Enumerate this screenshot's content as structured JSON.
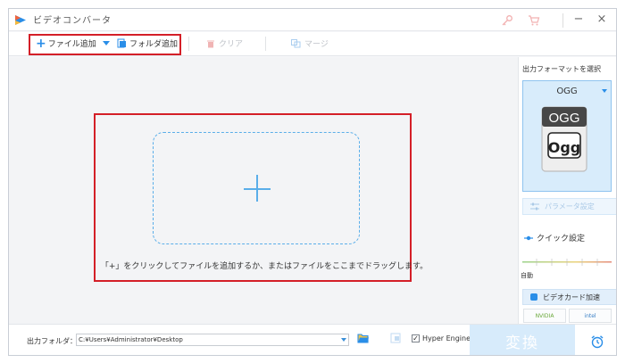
{
  "window": {
    "title": "ビデオコンバータ",
    "controls": {
      "minimize": "−",
      "maximize": "□",
      "close": "×"
    },
    "icons": [
      "app-logo-icon",
      "key-icon",
      "cart-icon"
    ]
  },
  "toolbar": {
    "add_file": "ファイル追加",
    "add_folder": "フォルダ追加",
    "clear": "クリア",
    "merge": "マージ"
  },
  "main": {
    "drop_plus": "+",
    "hint": "「+」をクリックしてファイルを追加するか、またはファイルをここまでドラッグします。"
  },
  "sidebar": {
    "title": "出力フォーマットを選択",
    "format": "OGG",
    "format_icon_label": "OGG",
    "format_logo": "Ogg",
    "param_settings": "パラメータ設定",
    "quick_settings": "クイック設定",
    "slider_label": "自動",
    "gpu_accel": "ビデオカード加速",
    "vendors": [
      "NVIDIA",
      "intel"
    ]
  },
  "bottom": {
    "output_folder_label": "出力フォルダ：",
    "output_path": "C:¥Users¥Administrator¥Desktop",
    "hyper_engine": "Hyper Engine",
    "hyper_engine_checked": true,
    "convert": "変換"
  },
  "colors": {
    "accent": "#2a8ee8",
    "highlight_border": "#d41f28",
    "convert_bg": "#d7ebfb"
  }
}
